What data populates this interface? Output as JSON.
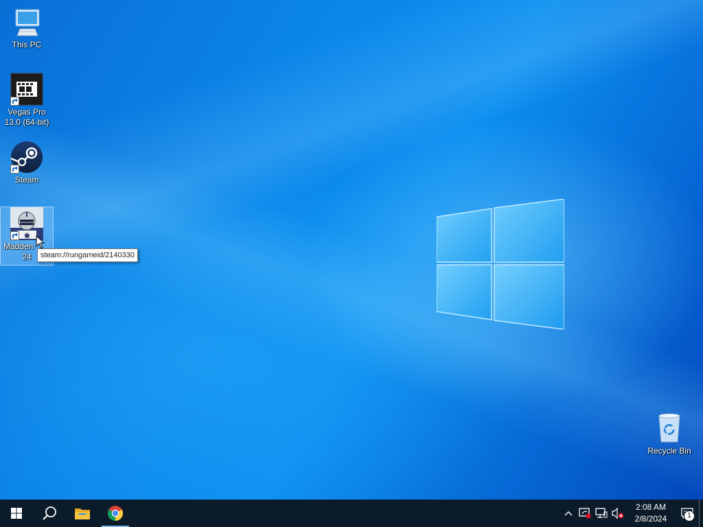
{
  "desktop": {
    "icons": [
      {
        "label": "This PC",
        "icon": "computer-icon"
      },
      {
        "label": "Vegas Pro 13.0 (64-bit)",
        "icon": "film-strip-icon"
      },
      {
        "label": "Steam",
        "icon": "steam-icon"
      },
      {
        "label_line1": "Madden",
        "label_line2": "24",
        "icon": "game-cover-icon"
      },
      {
        "label": "Recycle Bin",
        "icon": "recycle-bin-icon"
      }
    ],
    "tooltip": "steam://rungameid/2140330"
  },
  "taskbar": {
    "pinned": [
      "windows-start-icon",
      "search-icon",
      "file-explorer-icon",
      "chrome-icon"
    ],
    "tray": {
      "icons": [
        "chevron-up-icon",
        "security-warning-icon",
        "network-icon",
        "volume-muted-icon"
      ],
      "time": "2:08 AM",
      "date": "2/8/2024",
      "notification_count": "1"
    }
  },
  "colors": {
    "taskbar": "#0c1b2a",
    "accent": "#76b9ed"
  }
}
